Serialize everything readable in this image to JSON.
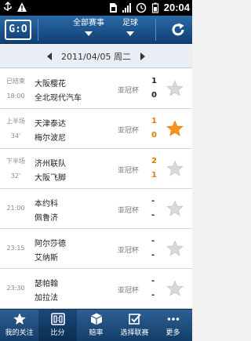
{
  "status_bar": {
    "time": "20:04",
    "icons_left": [
      "usb-icon",
      "warning-icon"
    ],
    "icons_right": [
      "sim-icon",
      "signal-icon",
      "alarm-icon",
      "battery-icon"
    ]
  },
  "toolbar": {
    "logo_text": "G:O",
    "filter_competition": "全部赛事",
    "filter_sport": "足球",
    "refresh_icon": "refresh-icon"
  },
  "date_bar": {
    "date": "2011/04/05 周二"
  },
  "colors": {
    "primary": "#1f5a94",
    "live_score": "#e07b00",
    "star_active": "#f7931e"
  },
  "matches": [
    {
      "status": "已结束",
      "time": "18:00",
      "home": "大阪樱花",
      "away": "全北现代汽车",
      "league": "亚冠杯",
      "home_score": "1",
      "away_score": "0",
      "favorite": false,
      "live": false
    },
    {
      "status": "上半场",
      "time": "34'",
      "home": "天津泰达",
      "away": "梅尔波尼",
      "league": "亚冠杯",
      "home_score": "1",
      "away_score": "0",
      "favorite": true,
      "live": true
    },
    {
      "status": "下半场",
      "time": "32'",
      "home": "济州联队",
      "away": "大阪飞脚",
      "league": "亚冠杯",
      "home_score": "2",
      "away_score": "1",
      "favorite": false,
      "live": true
    },
    {
      "status": "",
      "time": "21:00",
      "home": "本约科",
      "away": "佩鲁济",
      "league": "亚冠杯",
      "home_score": "-",
      "away_score": "-",
      "favorite": false,
      "live": false
    },
    {
      "status": "",
      "time": "23:15",
      "home": "阿尔莎德",
      "away": "艾纳斯",
      "league": "亚冠杯",
      "home_score": "-",
      "away_score": "-",
      "favorite": false,
      "live": false
    },
    {
      "status": "",
      "time": "23:30",
      "home": "瑟帕翰",
      "away": "加拉法",
      "league": "亚冠杯",
      "home_score": "-",
      "away_score": "-",
      "favorite": false,
      "live": false
    }
  ],
  "bottom_nav": [
    {
      "label": "我的关注",
      "icon": "star-icon",
      "active": false
    },
    {
      "label": "比分",
      "icon": "scoreboard-icon",
      "active": true
    },
    {
      "label": "赔率",
      "icon": "cube-icon",
      "active": false
    },
    {
      "label": "选择联赛",
      "icon": "checkbox-icon",
      "active": false
    },
    {
      "label": "更多",
      "icon": "more-icon",
      "active": false
    }
  ]
}
